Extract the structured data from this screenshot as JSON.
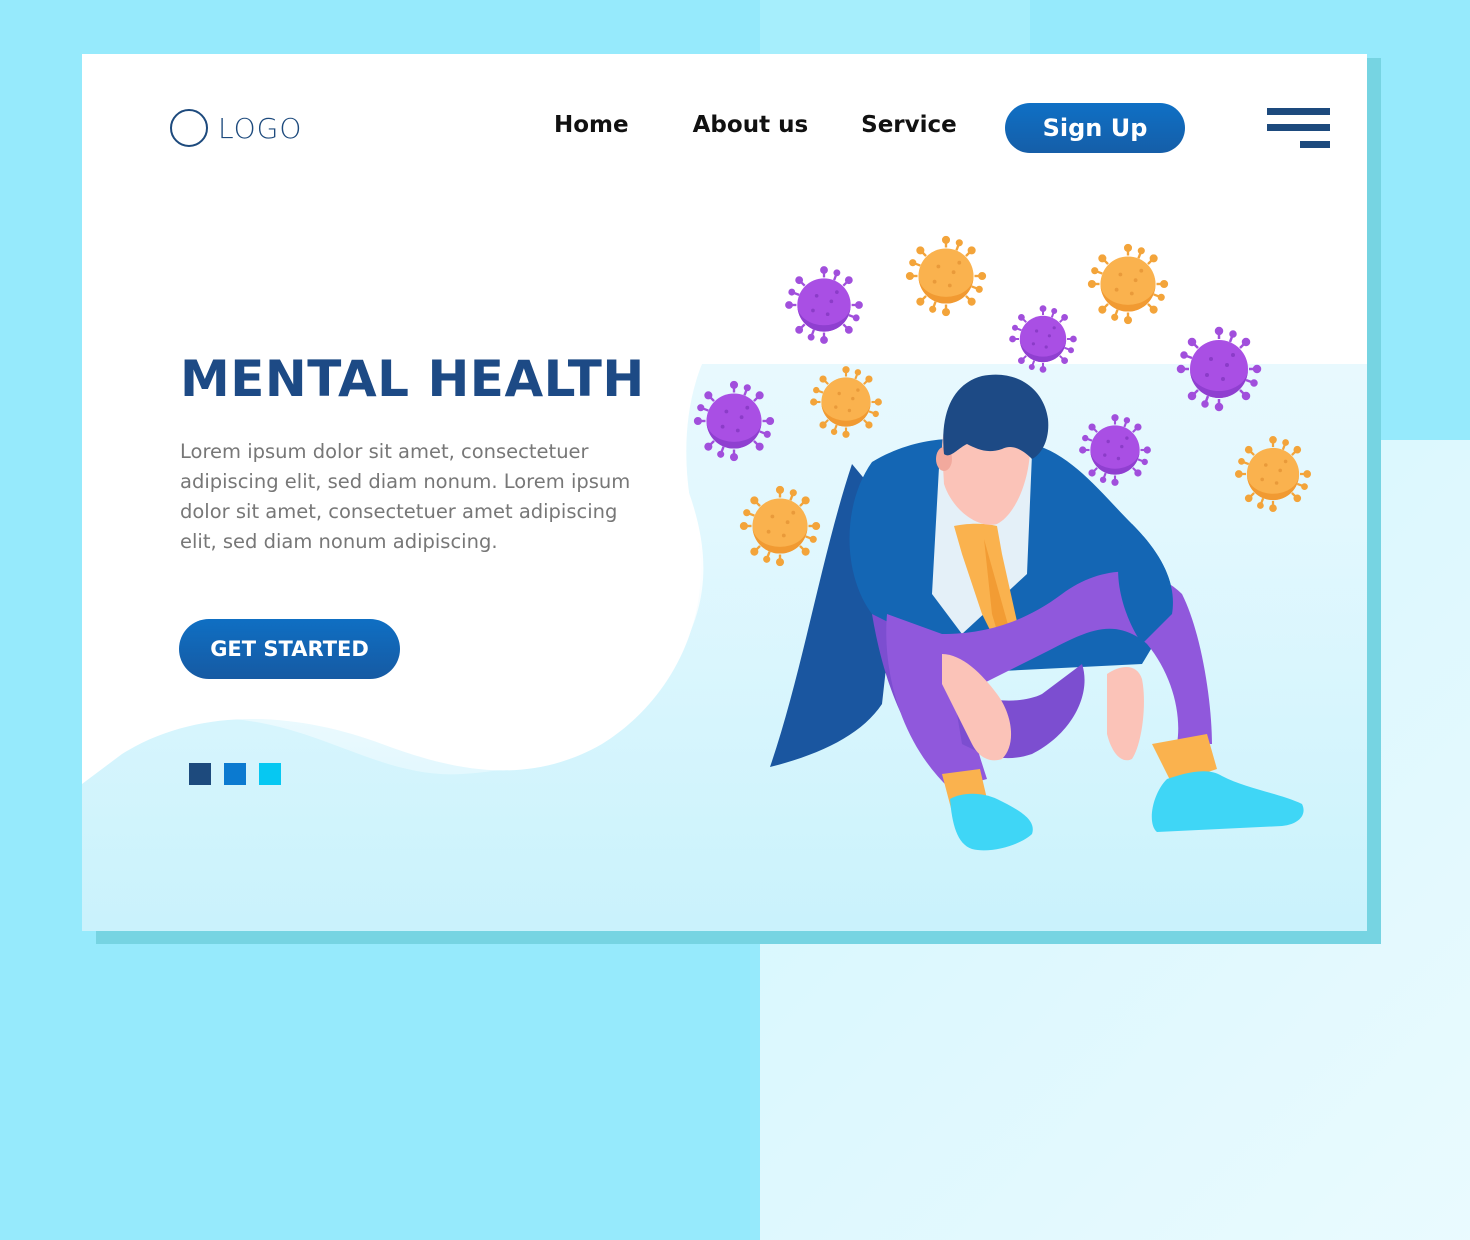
{
  "header": {
    "logo_text": "LOGO",
    "nav": [
      {
        "label": "Home"
      },
      {
        "label": "About us"
      },
      {
        "label": "Service"
      }
    ],
    "signup_label": "Sign Up",
    "menu_icon": "hamburger-menu-icon"
  },
  "hero": {
    "title": "MENTAL HEALTH",
    "description": "Lorem ipsum dolor sit amet, consectetuer adipiscing elit, sed diam nonum. Lorem ipsum dolor sit amet, consectetuer amet adipiscing elit, sed diam nonum adipiscing.",
    "cta_label": "GET STARTED",
    "slider_dots": [
      {
        "color": "#1d4a7d",
        "active": true
      },
      {
        "color": "#0b7ad0",
        "active": false
      },
      {
        "color": "#06c8f2",
        "active": false
      }
    ]
  },
  "illustration": {
    "subject": "stressed man sitting surrounded by viruses",
    "virus_colors": {
      "purple": "#a855e8",
      "orange": "#f9b04a"
    }
  },
  "colors": {
    "primary": "#1d4a85",
    "button": "#0f6fc3",
    "background": "#96eafc",
    "card_shadow": "#76d4e2"
  }
}
